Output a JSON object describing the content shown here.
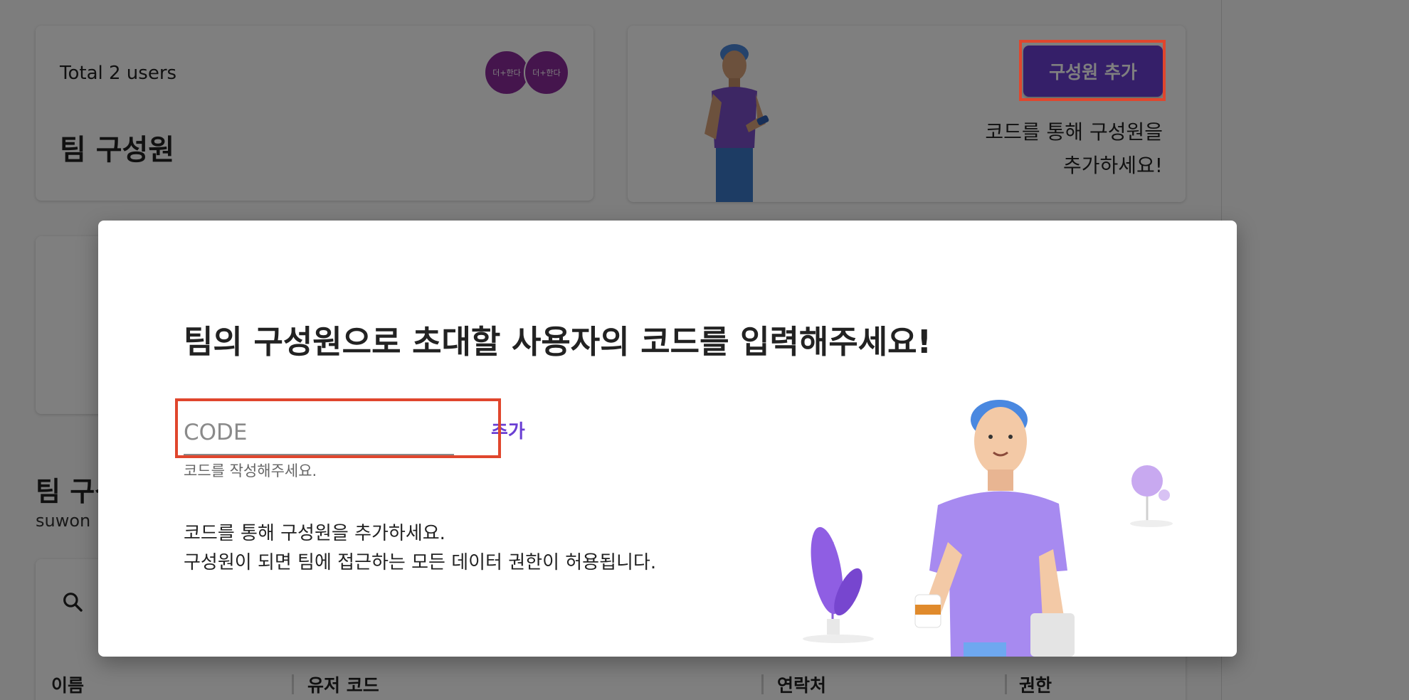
{
  "users_card": {
    "total_label": "Total 2 users",
    "title": "팀 구성원",
    "avatars": [
      {
        "label": "더+한다"
      },
      {
        "label": "더+한다"
      }
    ]
  },
  "invite_card": {
    "button_label": "구성원 추가",
    "text_line1": "코드를 통해 구성원을",
    "text_line2": "추가하세요!"
  },
  "members_section": {
    "title": "팀 구성원",
    "subtitle": "suwon",
    "columns": [
      "이름",
      "유저 코드",
      "연락처",
      "권한"
    ]
  },
  "modal": {
    "title": "팀의 구성원으로 초대할 사용자의 코드를 입력해주세요!",
    "code_input": {
      "placeholder": "CODE",
      "value": ""
    },
    "add_label": "추가",
    "helper_text": "코드를 작성해주세요.",
    "description_line1": "코드를 통해 구성원을 추가하세요.",
    "description_line2": "구성원이 되면 팀에 접근하는 모든 데이터 권한이 허용됩니다."
  },
  "colors": {
    "primary": "#6a3fd3",
    "highlight": "#e0462d",
    "avatar": "#8a2a9a",
    "overlay": "rgba(0,0,0,0.5)"
  }
}
